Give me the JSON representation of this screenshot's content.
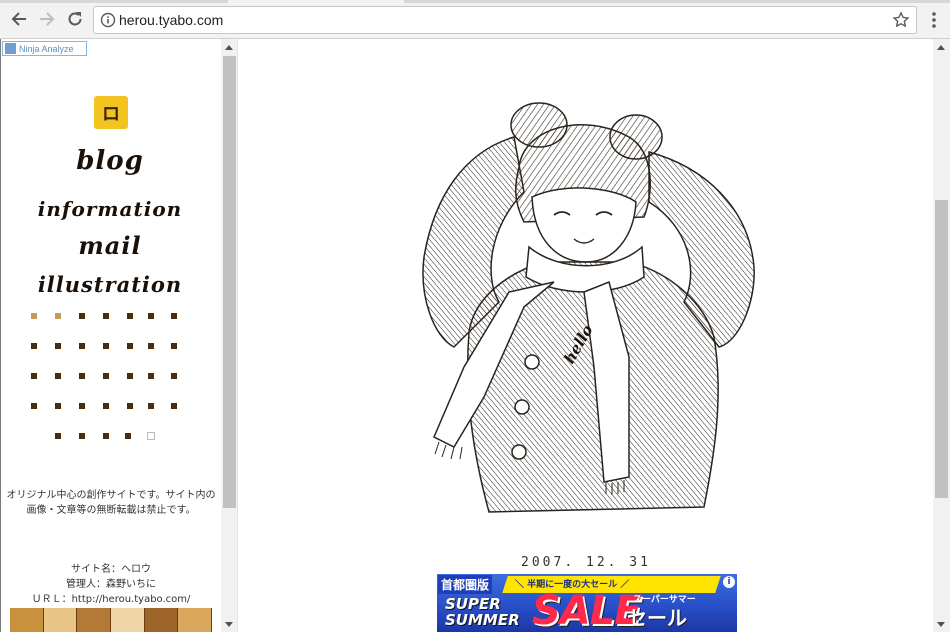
{
  "browser": {
    "url": "herou.tyabo.com",
    "icons": {
      "back": "arrow-left-icon",
      "forward": "arrow-right-icon",
      "reload": "reload-icon",
      "info": "info-circle-icon",
      "bookmark": "star-outline-icon",
      "menu": "vertical-dots-icon"
    }
  },
  "sidebar": {
    "badge_label": "Ninja Analyze",
    "logo_glyph": "ロ",
    "nav": [
      {
        "label": "blog"
      },
      {
        "label": "information"
      },
      {
        "label": "mail"
      },
      {
        "label": "illustration"
      }
    ],
    "description": "オリジナル中心の創作サイトです。サイト内の画像・文章等の無断転載は禁止です。",
    "site_name": "サイト名：ヘロウ",
    "admin": "管理人：森野いちに",
    "site_url": "ＵＲＬ：http://herou.tyabo.com/"
  },
  "main": {
    "illustration_text": "hello",
    "post_date": "2007. 12. 31",
    "ad": {
      "tag": "首都圏版",
      "subtitle": "＼ 半期に一度の大セール ／",
      "super": "SUPER",
      "summer": "SUMMER",
      "sale": "SALE",
      "sale_kana": "スーパーサマー",
      "sale_jp": "セール",
      "info": "i"
    }
  },
  "colors": {
    "logo_bg": "#f3c320",
    "dot_dark": "#4a2c0e",
    "dot_light": "#c69a63",
    "ad_blue": "#2a4fc8",
    "ad_red": "#ff2a4a"
  }
}
